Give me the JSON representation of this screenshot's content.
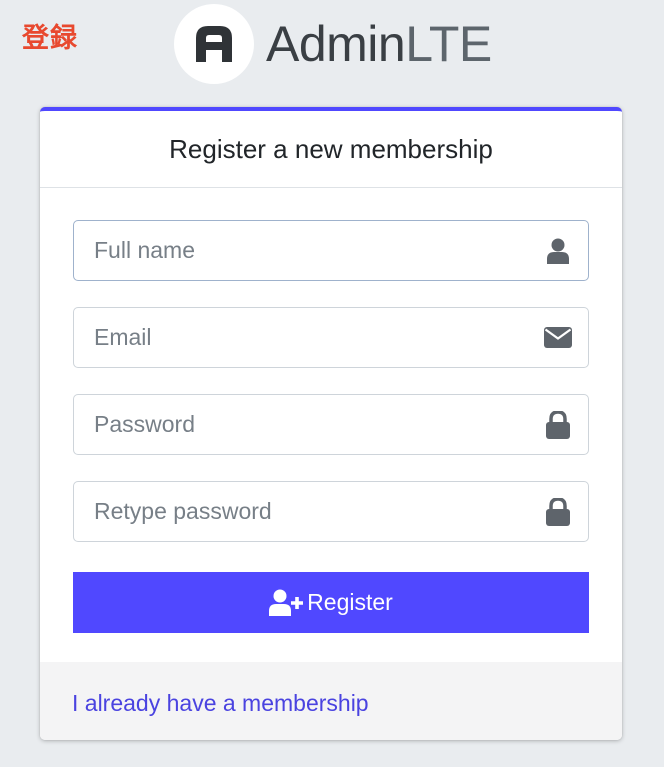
{
  "corner_tag": "登録",
  "brand": {
    "name_strong": "Admin",
    "name_light": "LTE"
  },
  "card": {
    "title": "Register a new membership",
    "fields": [
      {
        "placeholder": "Full name",
        "icon": "user-icon"
      },
      {
        "placeholder": "Email",
        "icon": "envelope-icon"
      },
      {
        "placeholder": "Password",
        "icon": "lock-icon"
      },
      {
        "placeholder": "Retype password",
        "icon": "lock-icon"
      }
    ],
    "register_label": "Register",
    "register_icon": "user-plus-icon",
    "footer_link": "I already have a membership"
  },
  "colors": {
    "accent": "#5048ff",
    "link": "#4a43e0",
    "tag": "#e8492f",
    "background": "#e9ecef"
  }
}
